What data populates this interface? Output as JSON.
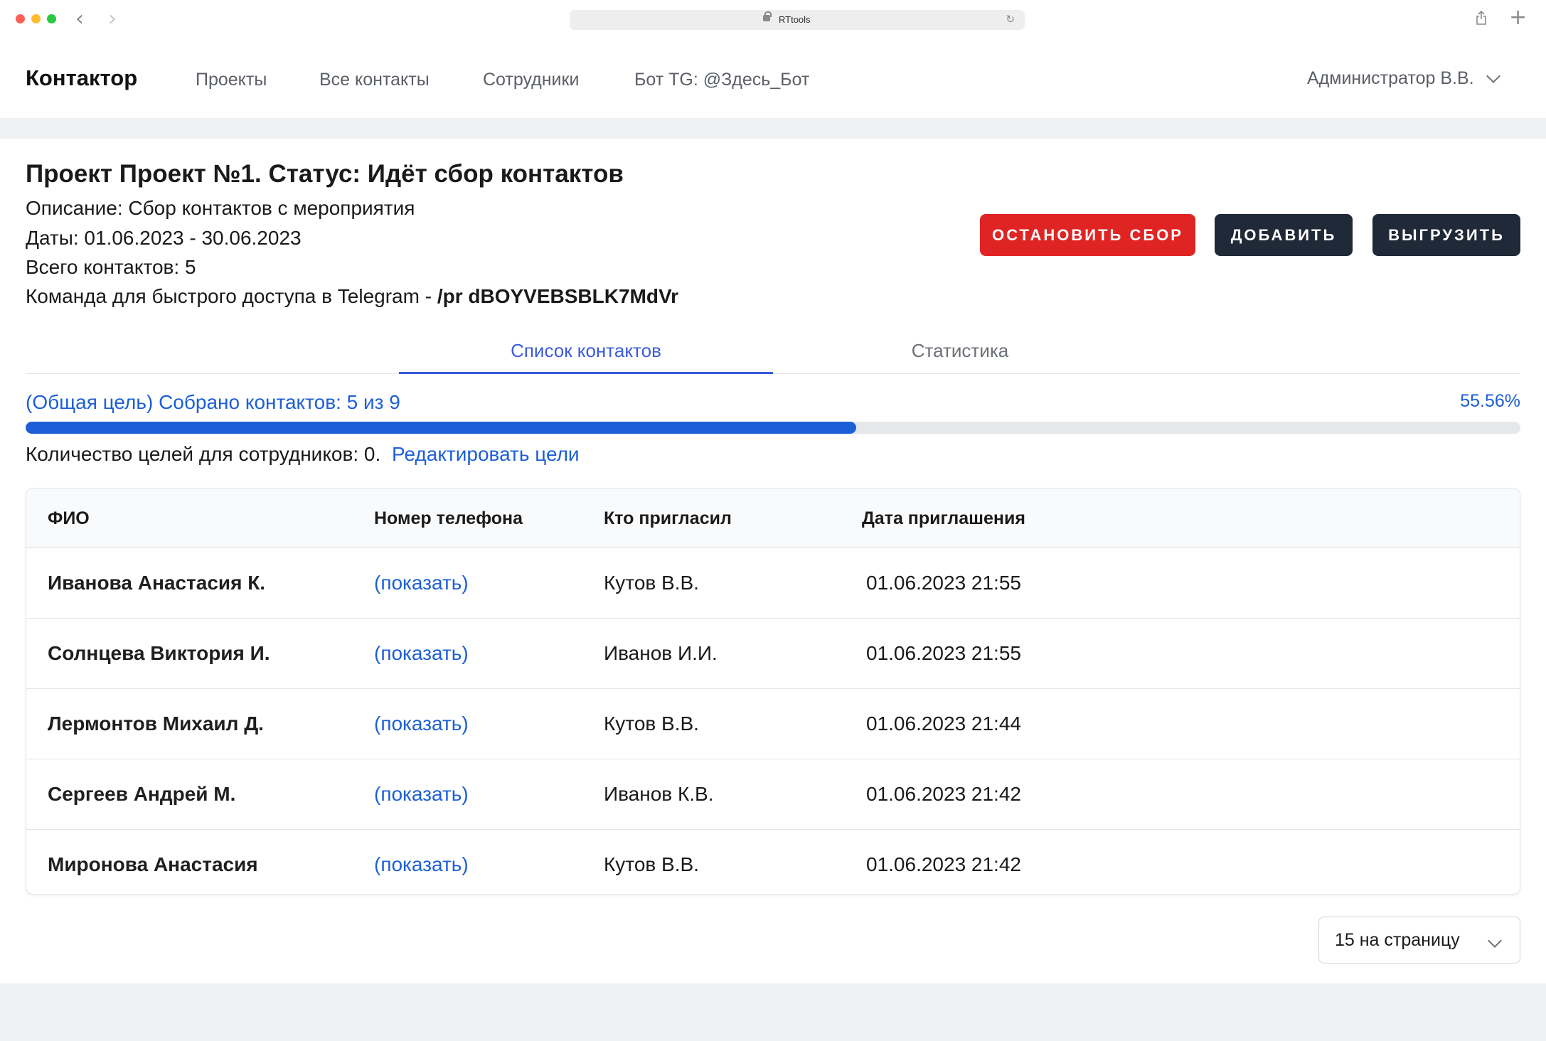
{
  "browser": {
    "url": "RTtools"
  },
  "header": {
    "brand": "Контактор",
    "nav": [
      "Проекты",
      "Все контакты",
      "Сотрудники",
      "Бот TG: @Здесь_Бот"
    ],
    "user": "Администратор В.В."
  },
  "project": {
    "title": "Проект Проект №1. Статус: Идёт сбор контактов",
    "description": "Описание: Сбор контактов с мероприятия",
    "dates": "Даты: 01.06.2023 - 30.06.2023",
    "total": "Всего контактов: 5",
    "telegram_prefix": "Команда для быстрого доступа в Telegram - ",
    "telegram_command": "/pr dBOYVEBSBLK7MdVr"
  },
  "actions": {
    "stop": "ОСТАНОВИТЬ СБОР",
    "add": "ДОБАВИТЬ",
    "export": "ВЫГРУЗИТЬ"
  },
  "tabs": [
    "Список контактов",
    "Статистика"
  ],
  "progress": {
    "label": "(Общая цель) Собрано контактов: 5 из 9",
    "percent_text": "55.56%",
    "fraction": 0.5556
  },
  "goals": {
    "text": "Количество целей для сотрудников: 0.",
    "edit_link": "Редактировать цели"
  },
  "table": {
    "columns": [
      "ФИО",
      "Номер телефона",
      "Кто пригласил",
      "Дата приглашения"
    ],
    "rows": [
      {
        "name": "Иванова Анастасия К.",
        "phone": "(показать)",
        "inviter": "Кутов В.В.",
        "date": "01.06.2023 21:55"
      },
      {
        "name": "Солнцева Виктория И.",
        "phone": "(показать)",
        "inviter": "Иванов И.И.",
        "date": "01.06.2023 21:55"
      },
      {
        "name": "Лермонтов Михаил Д.",
        "phone": "(показать)",
        "inviter": "Кутов В.В.",
        "date": "01.06.2023 21:44"
      },
      {
        "name": "Сергеев Андрей М.",
        "phone": "(показать)",
        "inviter": "Иванов К.В.",
        "date": "01.06.2023 21:42"
      },
      {
        "name": "Миронова Анастасия",
        "phone": "(показать)",
        "inviter": "Кутов В.В.",
        "date": "01.06.2023 21:42"
      }
    ]
  },
  "pagination": {
    "per_page": "15 на страницу"
  }
}
